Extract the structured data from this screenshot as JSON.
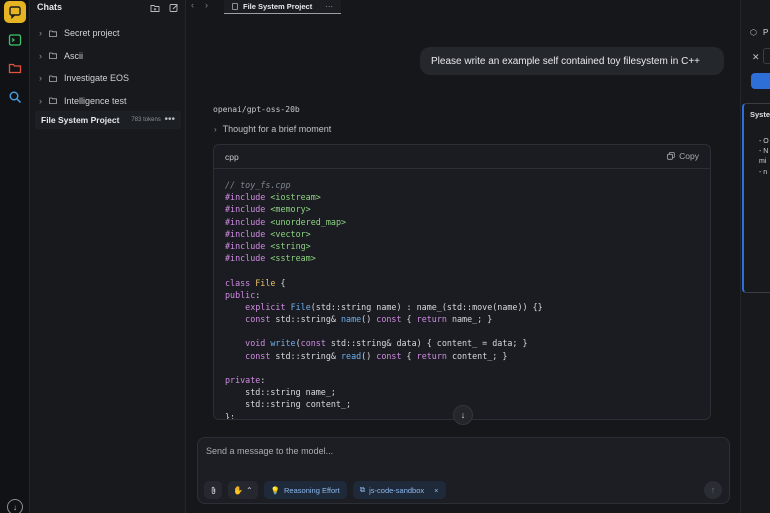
{
  "colors": {
    "accent": "#e6b422",
    "primary_blue": "#2d6fd6",
    "keyword": "#d08ce2",
    "header": "#8fd282",
    "type": "#e8c06a",
    "function": "#6fb0ee",
    "comment": "#7f8791"
  },
  "activity_bar": {
    "items": [
      {
        "name": "chat-icon",
        "active": true
      },
      {
        "name": "terminal-icon",
        "active": false
      },
      {
        "name": "folder-icon",
        "active": false
      },
      {
        "name": "search-icon",
        "active": false
      }
    ],
    "bottom_icon": "download-icon"
  },
  "sidebar": {
    "title": "Chats",
    "folders": [
      {
        "label": "Secret project"
      },
      {
        "label": "Ascii"
      },
      {
        "label": "Investigate EOS"
      },
      {
        "label": "Intelligence test"
      }
    ],
    "active_chat": {
      "name": "File System Project",
      "tokens": "783 tokens",
      "more": "•••"
    }
  },
  "tabbar": {
    "back": "‹",
    "forward": "›",
    "tab_label": "File System Project",
    "tab_more": "···"
  },
  "chat": {
    "user_message": "Please write an example self contained toy filesystem in C++",
    "model_name": "openai/gpt-oss-20b",
    "thought_label": "Thought for a brief moment",
    "code": {
      "language": "cpp",
      "copy_label": "Copy",
      "lines": [
        [
          {
            "c": "t-comment",
            "t": "// toy_fs.cpp"
          }
        ],
        [
          {
            "c": "t-kw",
            "t": "#include"
          },
          {
            "c": "t-plain",
            "t": " "
          },
          {
            "c": "t-hdr",
            "t": "<iostream>"
          }
        ],
        [
          {
            "c": "t-kw",
            "t": "#include"
          },
          {
            "c": "t-plain",
            "t": " "
          },
          {
            "c": "t-hdr",
            "t": "<memory>"
          }
        ],
        [
          {
            "c": "t-kw",
            "t": "#include"
          },
          {
            "c": "t-plain",
            "t": " "
          },
          {
            "c": "t-hdr",
            "t": "<unordered_map>"
          }
        ],
        [
          {
            "c": "t-kw",
            "t": "#include"
          },
          {
            "c": "t-plain",
            "t": " "
          },
          {
            "c": "t-hdr",
            "t": "<vector>"
          }
        ],
        [
          {
            "c": "t-kw",
            "t": "#include"
          },
          {
            "c": "t-plain",
            "t": " "
          },
          {
            "c": "t-hdr",
            "t": "<string>"
          }
        ],
        [
          {
            "c": "t-kw",
            "t": "#include"
          },
          {
            "c": "t-plain",
            "t": " "
          },
          {
            "c": "t-hdr",
            "t": "<sstream>"
          }
        ],
        [],
        [
          {
            "c": "t-kw",
            "t": "class"
          },
          {
            "c": "t-plain",
            "t": " "
          },
          {
            "c": "t-type",
            "t": "File"
          },
          {
            "c": "t-plain",
            "t": " {"
          }
        ],
        [
          {
            "c": "t-kw",
            "t": "public"
          },
          {
            "c": "t-plain",
            "t": ":"
          }
        ],
        [
          {
            "c": "t-plain",
            "t": "    "
          },
          {
            "c": "t-kw",
            "t": "explicit"
          },
          {
            "c": "t-plain",
            "t": " "
          },
          {
            "c": "t-fn",
            "t": "File"
          },
          {
            "c": "t-plain",
            "t": "(std::string name) : name_(std::move(name)) {}"
          }
        ],
        [
          {
            "c": "t-plain",
            "t": "    "
          },
          {
            "c": "t-kw",
            "t": "const"
          },
          {
            "c": "t-plain",
            "t": " std::string& "
          },
          {
            "c": "t-fn",
            "t": "name"
          },
          {
            "c": "t-plain",
            "t": "() "
          },
          {
            "c": "t-kw",
            "t": "const"
          },
          {
            "c": "t-plain",
            "t": " { "
          },
          {
            "c": "t-kw",
            "t": "return"
          },
          {
            "c": "t-plain",
            "t": " name_; }"
          }
        ],
        [],
        [
          {
            "c": "t-plain",
            "t": "    "
          },
          {
            "c": "t-kw",
            "t": "void"
          },
          {
            "c": "t-plain",
            "t": " "
          },
          {
            "c": "t-fn",
            "t": "write"
          },
          {
            "c": "t-plain",
            "t": "("
          },
          {
            "c": "t-kw",
            "t": "const"
          },
          {
            "c": "t-plain",
            "t": " std::string& data) { content_ = data; }"
          }
        ],
        [
          {
            "c": "t-plain",
            "t": "    "
          },
          {
            "c": "t-kw",
            "t": "const"
          },
          {
            "c": "t-plain",
            "t": " std::string& "
          },
          {
            "c": "t-fn",
            "t": "read"
          },
          {
            "c": "t-plain",
            "t": "() "
          },
          {
            "c": "t-kw",
            "t": "const"
          },
          {
            "c": "t-plain",
            "t": " { "
          },
          {
            "c": "t-kw",
            "t": "return"
          },
          {
            "c": "t-plain",
            "t": " content_; }"
          }
        ],
        [],
        [
          {
            "c": "t-kw",
            "t": "private"
          },
          {
            "c": "t-plain",
            "t": ":"
          }
        ],
        [
          {
            "c": "t-plain",
            "t": "    std::string name_;"
          }
        ],
        [
          {
            "c": "t-plain",
            "t": "    std::string content_;"
          }
        ],
        [
          {
            "c": "t-plain",
            "t": "};"
          }
        ]
      ]
    }
  },
  "composer": {
    "placeholder": "Send a message to the model...",
    "value": "",
    "reasoning_label": "Reasoning Effort",
    "sandbox_label": "js-code-sandbox",
    "remove_label": "×",
    "model_caret": "⌃"
  },
  "right_panel": {
    "title": "P",
    "section_title": "Syste",
    "lines": [
      "- O",
      "- N",
      "mi",
      "- n"
    ]
  }
}
